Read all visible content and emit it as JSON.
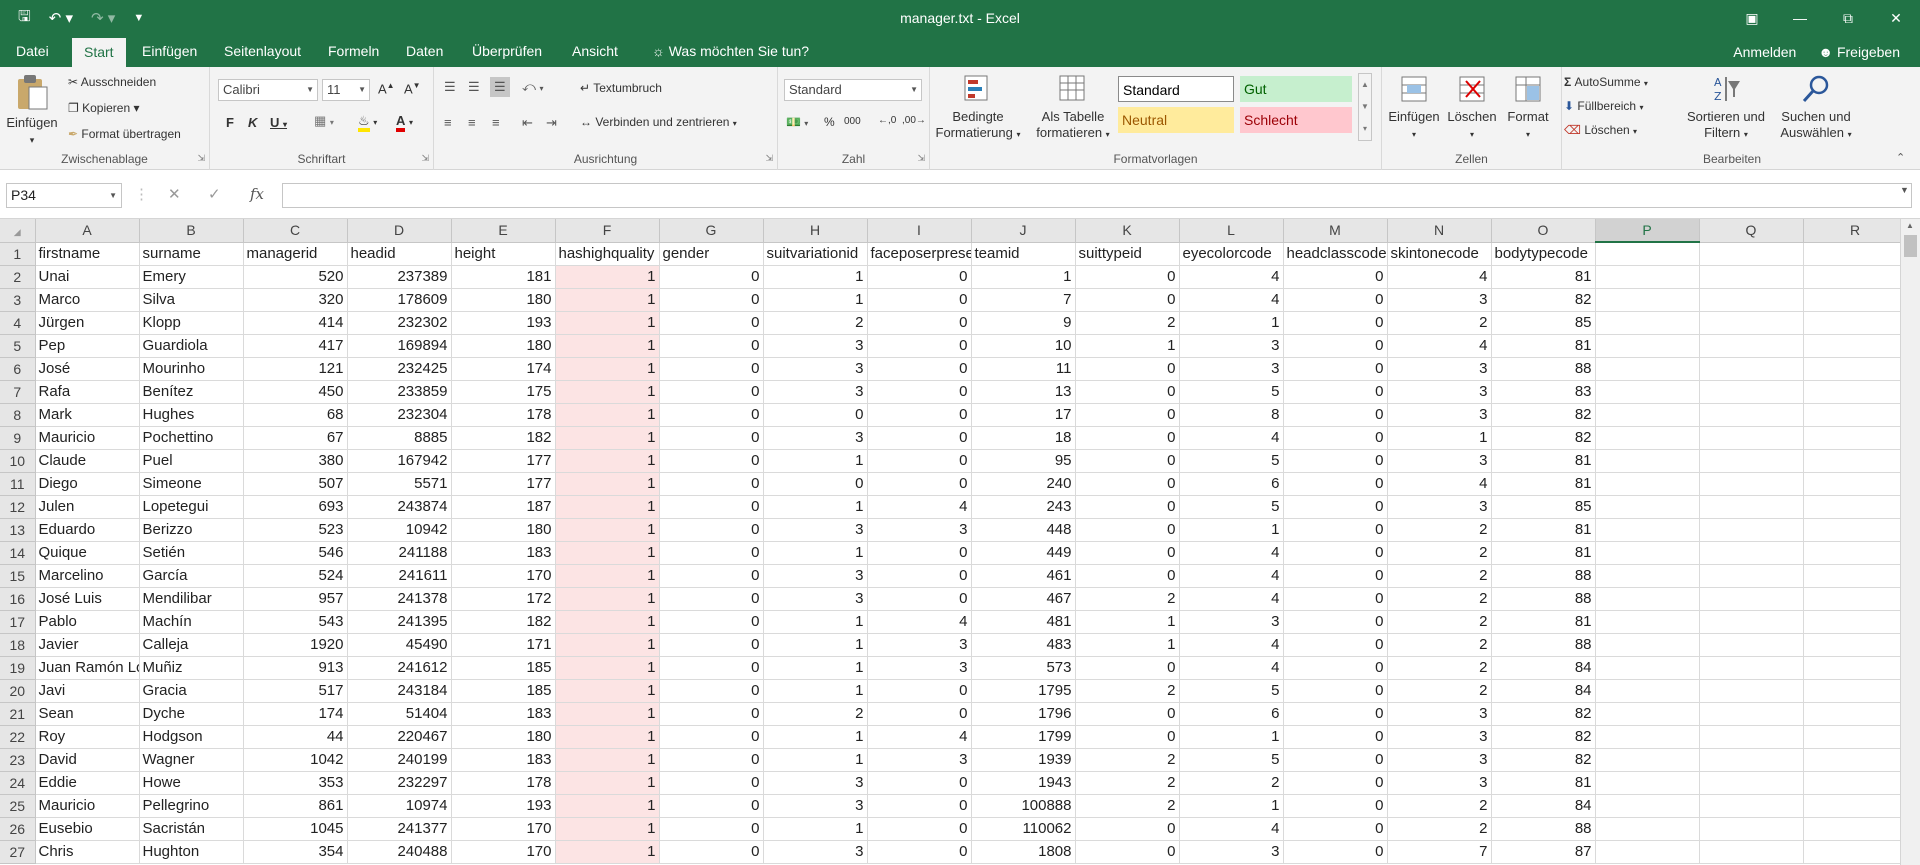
{
  "window": {
    "title": "manager.txt - Excel"
  },
  "tabs": [
    "Datei",
    "Start",
    "Einfügen",
    "Seitenlayout",
    "Formeln",
    "Daten",
    "Überprüfen",
    "Ansicht"
  ],
  "tellme": "Was möchten Sie tun?",
  "account": {
    "signin": "Anmelden",
    "share": "Freigeben"
  },
  "ribbon": {
    "clipboard": {
      "paste": "Einfügen",
      "cut": "Ausschneiden",
      "copy": "Kopieren",
      "format_painter": "Format übertragen",
      "label": "Zwischenablage"
    },
    "font": {
      "name": "Calibri",
      "size": "11",
      "label": "Schriftart"
    },
    "alignment": {
      "wrap": "Textumbruch",
      "merge": "Verbinden und zentrieren",
      "label": "Ausrichtung"
    },
    "number": {
      "format": "Standard",
      "label": "Zahl"
    },
    "styles": {
      "cond_line1": "Bedingte",
      "cond_line2": "Formatierung",
      "table_line1": "Als Tabelle",
      "table_line2": "formatieren",
      "standard": "Standard",
      "gut": "Gut",
      "neutral": "Neutral",
      "schlecht": "Schlecht",
      "label": "Formatvorlagen"
    },
    "cells": {
      "insert": "Einfügen",
      "delete": "Löschen",
      "format": "Format",
      "label": "Zellen"
    },
    "editing": {
      "autosum": "AutoSumme",
      "fill": "Füllbereich",
      "clear": "Löschen",
      "sort_line1": "Sortieren und",
      "sort_line2": "Filtern",
      "find_line1": "Suchen und",
      "find_line2": "Auswählen",
      "label": "Bearbeiten"
    }
  },
  "formula_bar": {
    "name_box": "P34",
    "fx": "fx",
    "formula": ""
  },
  "sheet": {
    "columns": [
      "A",
      "B",
      "C",
      "D",
      "E",
      "F",
      "G",
      "H",
      "I",
      "J",
      "K",
      "L",
      "M",
      "N",
      "O",
      "P",
      "Q",
      "R"
    ],
    "selected_column": "P",
    "rows": [
      [
        "firstname",
        "surname",
        "managerid",
        "headid",
        "height",
        "hashighquality",
        "gender",
        "suitvariationid",
        "faceposerpreset",
        "teamid",
        "suittypeid",
        "eyecolorcode",
        "headclasscode",
        "skintonecode",
        "bodytypecode"
      ],
      [
        "Unai",
        "Emery",
        "520",
        "237389",
        "181",
        "1",
        "0",
        "1",
        "0",
        "1",
        "0",
        "4",
        "0",
        "4",
        "81"
      ],
      [
        "Marco",
        "Silva",
        "320",
        "178609",
        "180",
        "1",
        "0",
        "1",
        "0",
        "7",
        "0",
        "4",
        "0",
        "3",
        "82"
      ],
      [
        "Jürgen",
        "Klopp",
        "414",
        "232302",
        "193",
        "1",
        "0",
        "2",
        "0",
        "9",
        "2",
        "1",
        "0",
        "2",
        "85"
      ],
      [
        "Pep",
        "Guardiola",
        "417",
        "169894",
        "180",
        "1",
        "0",
        "3",
        "0",
        "10",
        "1",
        "3",
        "0",
        "4",
        "81"
      ],
      [
        "José",
        "Mourinho",
        "121",
        "232425",
        "174",
        "1",
        "0",
        "3",
        "0",
        "11",
        "0",
        "3",
        "0",
        "3",
        "88"
      ],
      [
        "Rafa",
        "Benítez",
        "450",
        "233859",
        "175",
        "1",
        "0",
        "3",
        "0",
        "13",
        "0",
        "5",
        "0",
        "3",
        "83"
      ],
      [
        "Mark",
        "Hughes",
        "68",
        "232304",
        "178",
        "1",
        "0",
        "0",
        "0",
        "17",
        "0",
        "8",
        "0",
        "3",
        "82"
      ],
      [
        "Mauricio",
        "Pochettino",
        "67",
        "8885",
        "182",
        "1",
        "0",
        "3",
        "0",
        "18",
        "0",
        "4",
        "0",
        "1",
        "82"
      ],
      [
        "Claude",
        "Puel",
        "380",
        "167942",
        "177",
        "1",
        "0",
        "1",
        "0",
        "95",
        "0",
        "5",
        "0",
        "3",
        "81"
      ],
      [
        "Diego",
        "Simeone",
        "507",
        "5571",
        "177",
        "1",
        "0",
        "0",
        "0",
        "240",
        "0",
        "6",
        "0",
        "4",
        "81"
      ],
      [
        "Julen",
        "Lopetegui",
        "693",
        "243874",
        "187",
        "1",
        "0",
        "1",
        "4",
        "243",
        "0",
        "5",
        "0",
        "3",
        "85"
      ],
      [
        "Eduardo",
        "Berizzo",
        "523",
        "10942",
        "180",
        "1",
        "0",
        "3",
        "3",
        "448",
        "0",
        "1",
        "0",
        "2",
        "81"
      ],
      [
        "Quique",
        "Setién",
        "546",
        "241188",
        "183",
        "1",
        "0",
        "1",
        "0",
        "449",
        "0",
        "4",
        "0",
        "2",
        "81"
      ],
      [
        "Marcelino",
        "García",
        "524",
        "241611",
        "170",
        "1",
        "0",
        "3",
        "0",
        "461",
        "0",
        "4",
        "0",
        "2",
        "88"
      ],
      [
        "José Luis",
        "Mendilibar",
        "957",
        "241378",
        "172",
        "1",
        "0",
        "3",
        "0",
        "467",
        "2",
        "4",
        "0",
        "2",
        "88"
      ],
      [
        "Pablo",
        "Machín",
        "543",
        "241395",
        "182",
        "1",
        "0",
        "1",
        "4",
        "481",
        "1",
        "3",
        "0",
        "2",
        "81"
      ],
      [
        "Javier",
        "Calleja",
        "1920",
        "45490",
        "171",
        "1",
        "0",
        "1",
        "3",
        "483",
        "1",
        "4",
        "0",
        "2",
        "88"
      ],
      [
        "Juan Ramón López",
        "Muñiz",
        "913",
        "241612",
        "185",
        "1",
        "0",
        "1",
        "3",
        "573",
        "0",
        "4",
        "0",
        "2",
        "84"
      ],
      [
        "Javi",
        "Gracia",
        "517",
        "243184",
        "185",
        "1",
        "0",
        "1",
        "0",
        "1795",
        "2",
        "5",
        "0",
        "2",
        "84"
      ],
      [
        "Sean",
        "Dyche",
        "174",
        "51404",
        "183",
        "1",
        "0",
        "2",
        "0",
        "1796",
        "0",
        "6",
        "0",
        "3",
        "82"
      ],
      [
        "Roy",
        "Hodgson",
        "44",
        "220467",
        "180",
        "1",
        "0",
        "1",
        "4",
        "1799",
        "0",
        "1",
        "0",
        "3",
        "82"
      ],
      [
        "David",
        "Wagner",
        "1042",
        "240199",
        "183",
        "1",
        "0",
        "1",
        "3",
        "1939",
        "2",
        "5",
        "0",
        "3",
        "82"
      ],
      [
        "Eddie",
        "Howe",
        "353",
        "232297",
        "178",
        "1",
        "0",
        "3",
        "0",
        "1943",
        "2",
        "2",
        "0",
        "3",
        "81"
      ],
      [
        "Mauricio",
        "Pellegrino",
        "861",
        "10974",
        "193",
        "1",
        "0",
        "3",
        "0",
        "100888",
        "2",
        "1",
        "0",
        "2",
        "84"
      ],
      [
        "Eusebio",
        "Sacristán",
        "1045",
        "241377",
        "170",
        "1",
        "0",
        "1",
        "0",
        "110062",
        "0",
        "4",
        "0",
        "2",
        "88"
      ],
      [
        "Chris",
        "Hughton",
        "354",
        "240488",
        "170",
        "1",
        "0",
        "3",
        "0",
        "1808",
        "0",
        "3",
        "0",
        "7",
        "87"
      ]
    ]
  }
}
